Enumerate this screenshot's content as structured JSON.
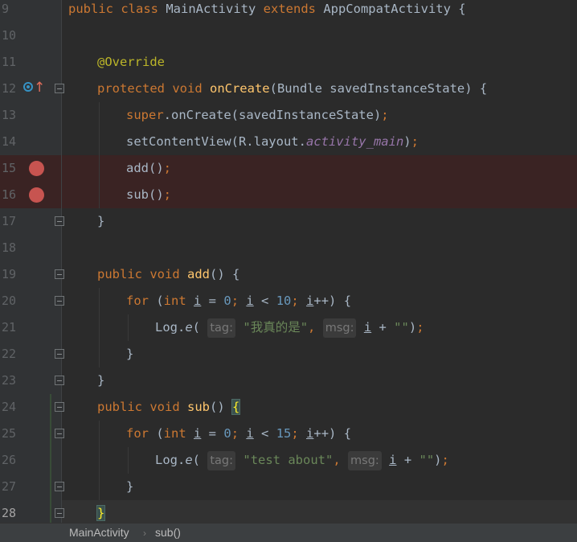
{
  "editor": {
    "lines": [
      {
        "num": "9",
        "tokens": [
          {
            "t": "public class ",
            "c": "kw"
          },
          {
            "t": "MainActivity "
          },
          {
            "t": "extends ",
            "c": "kw"
          },
          {
            "t": "AppCompatActivity {"
          }
        ]
      },
      {
        "num": "10",
        "tokens": []
      },
      {
        "num": "11",
        "indent": 1,
        "tokens": [
          {
            "t": "@Override",
            "c": "an"
          }
        ]
      },
      {
        "num": "12",
        "indent": 1,
        "gutter": "override",
        "fold": true,
        "tokens": [
          {
            "t": "protected void ",
            "c": "kw"
          },
          {
            "t": "onCreate",
            "c": "fn"
          },
          {
            "t": "(Bundle savedInstanceState) {"
          }
        ]
      },
      {
        "num": "13",
        "indent": 2,
        "tokens": [
          {
            "t": "super",
            "c": "kw"
          },
          {
            "t": ".onCreate(savedInstanceState)"
          },
          {
            "t": ";",
            "c": "kw"
          }
        ]
      },
      {
        "num": "14",
        "indent": 2,
        "tokens": [
          {
            "t": "setContentView(R.layout."
          },
          {
            "t": "activity_main",
            "c": "sf"
          },
          {
            "t": ")"
          },
          {
            "t": ";",
            "c": "kw"
          }
        ]
      },
      {
        "num": "15",
        "indent": 2,
        "breakpoint": true,
        "tokens": [
          {
            "t": "add()"
          },
          {
            "t": ";",
            "c": "kw"
          }
        ]
      },
      {
        "num": "16",
        "indent": 2,
        "breakpoint": true,
        "tokens": [
          {
            "t": "sub()"
          },
          {
            "t": ";",
            "c": "kw"
          }
        ]
      },
      {
        "num": "17",
        "indent": 1,
        "fold": true,
        "tokens": [
          {
            "t": "}"
          }
        ]
      },
      {
        "num": "18",
        "tokens": []
      },
      {
        "num": "19",
        "indent": 1,
        "fold": true,
        "tokens": [
          {
            "t": "public void ",
            "c": "kw"
          },
          {
            "t": "add",
            "c": "fn"
          },
          {
            "t": "() {"
          }
        ]
      },
      {
        "num": "20",
        "indent": 2,
        "fold": true,
        "tokens": [
          {
            "t": "for ",
            "c": "kw"
          },
          {
            "t": "("
          },
          {
            "t": "int ",
            "c": "kw"
          },
          {
            "t": "i",
            "c": "ul"
          },
          {
            "t": " = "
          },
          {
            "t": "0",
            "c": "num"
          },
          {
            "t": "; ",
            "c": "kw"
          },
          {
            "t": "i",
            "c": "ul"
          },
          {
            "t": " < "
          },
          {
            "t": "10",
            "c": "num"
          },
          {
            "t": "; ",
            "c": "kw"
          },
          {
            "t": "i",
            "c": "ul"
          },
          {
            "t": "++) {"
          }
        ]
      },
      {
        "num": "21",
        "indent": 3,
        "tokens": [
          {
            "t": "Log."
          },
          {
            "t": "e",
            "c": "mc"
          },
          {
            "t": "( "
          },
          {
            "t": "tag:",
            "c": "hint"
          },
          {
            "t": " "
          },
          {
            "t": "\"我真的是\"",
            "c": "str"
          },
          {
            "t": ", ",
            "c": "kw"
          },
          {
            "t": "msg:",
            "c": "hint"
          },
          {
            "t": " "
          },
          {
            "t": "i",
            "c": "ul"
          },
          {
            "t": " + "
          },
          {
            "t": "\"\"",
            "c": "str"
          },
          {
            "t": ")"
          },
          {
            "t": ";",
            "c": "kw"
          }
        ]
      },
      {
        "num": "22",
        "indent": 2,
        "fold": true,
        "tokens": [
          {
            "t": "}"
          }
        ]
      },
      {
        "num": "23",
        "indent": 1,
        "fold": true,
        "tokens": [
          {
            "t": "}"
          }
        ]
      },
      {
        "num": "24",
        "indent": 1,
        "fold": true,
        "vcs": true,
        "tokens": [
          {
            "t": "public void ",
            "c": "kw"
          },
          {
            "t": "sub",
            "c": "fn"
          },
          {
            "t": "() "
          },
          {
            "t": "{",
            "c": "brm"
          }
        ]
      },
      {
        "num": "25",
        "indent": 2,
        "fold": true,
        "vcs": true,
        "tokens": [
          {
            "t": "for ",
            "c": "kw"
          },
          {
            "t": "("
          },
          {
            "t": "int ",
            "c": "kw"
          },
          {
            "t": "i",
            "c": "ul"
          },
          {
            "t": " = "
          },
          {
            "t": "0",
            "c": "num"
          },
          {
            "t": "; ",
            "c": "kw"
          },
          {
            "t": "i",
            "c": "ul"
          },
          {
            "t": " < "
          },
          {
            "t": "15",
            "c": "num"
          },
          {
            "t": "; ",
            "c": "kw"
          },
          {
            "t": "i",
            "c": "ul"
          },
          {
            "t": "++) {"
          }
        ]
      },
      {
        "num": "26",
        "indent": 3,
        "vcs": true,
        "tokens": [
          {
            "t": "Log."
          },
          {
            "t": "e",
            "c": "mc"
          },
          {
            "t": "( "
          },
          {
            "t": "tag:",
            "c": "hint"
          },
          {
            "t": " "
          },
          {
            "t": "\"test about\"",
            "c": "str"
          },
          {
            "t": ", ",
            "c": "kw"
          },
          {
            "t": "msg:",
            "c": "hint"
          },
          {
            "t": " "
          },
          {
            "t": "i",
            "c": "ul"
          },
          {
            "t": " + "
          },
          {
            "t": "\"\"",
            "c": "str"
          },
          {
            "t": ")"
          },
          {
            "t": ";",
            "c": "kw"
          }
        ]
      },
      {
        "num": "27",
        "indent": 2,
        "fold": true,
        "vcs": true,
        "tokens": [
          {
            "t": "}"
          }
        ]
      },
      {
        "num": "28",
        "indent": 1,
        "fold": true,
        "vcs": true,
        "current": true,
        "tokens": [
          {
            "t": "}",
            "c": "brm"
          }
        ]
      }
    ]
  },
  "breadcrumb": {
    "class_name": "MainActivity",
    "separator": "›",
    "method_name": "sub()"
  }
}
